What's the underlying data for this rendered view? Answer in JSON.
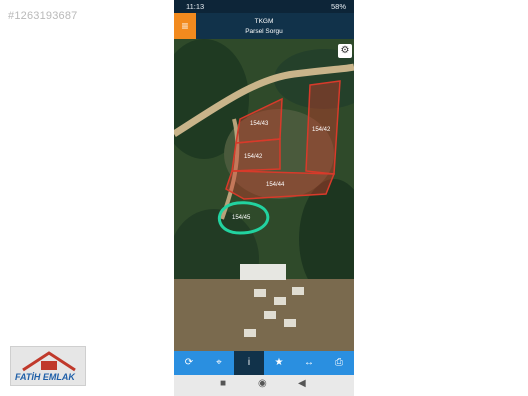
{
  "listing": {
    "id": "#1263193687"
  },
  "watermark": {
    "brand": "FATİH EMLAK"
  },
  "status_bar": {
    "time": "11:13",
    "battery": "58%"
  },
  "app": {
    "title": "TKGM",
    "subtitle": "Parsel Sorgu"
  },
  "map": {
    "parcel_labels": [
      "154/43",
      "154/42",
      "154/42",
      "154/44",
      "154/45"
    ]
  },
  "toolbar": {
    "items": [
      {
        "icon": "refresh-icon",
        "glyph": "⟳"
      },
      {
        "icon": "locate-icon",
        "glyph": "⌖"
      },
      {
        "icon": "info-icon",
        "glyph": "i"
      },
      {
        "icon": "star-icon",
        "glyph": "★"
      },
      {
        "icon": "measure-icon",
        "glyph": "↔"
      },
      {
        "icon": "print-icon",
        "glyph": "⎙"
      }
    ]
  },
  "colors": {
    "accent": "#f28a1e",
    "appbar": "#11324a",
    "toolbar": "#2a8fe0",
    "parcel": "#d83a2a",
    "highlight": "#22d3a0"
  }
}
